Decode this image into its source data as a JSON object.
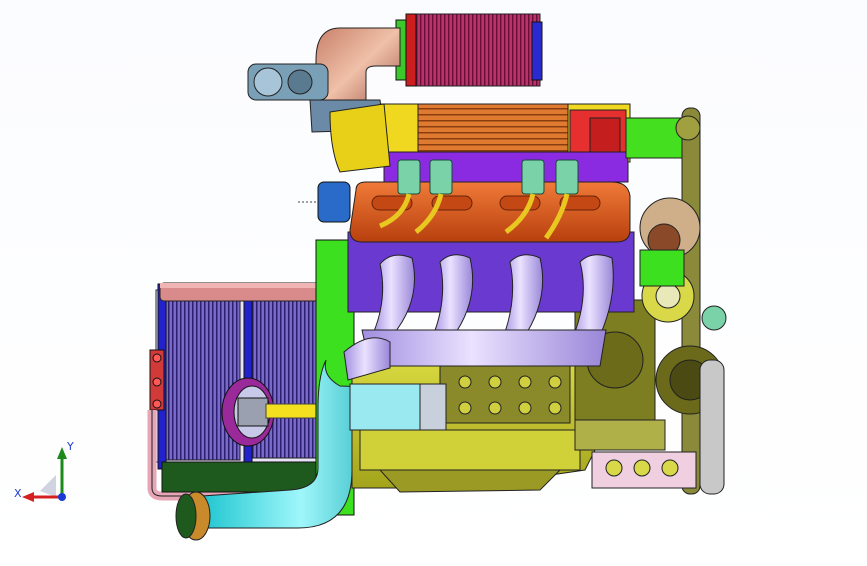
{
  "viewport": {
    "model": "supercharged-v8-engine-assembly",
    "colors": {
      "background": "#ffffff",
      "cylinder_head": "#d9531e",
      "intake_plenum": "#8a2be2",
      "block": "#c9c931",
      "headers": "#c8b8f0",
      "intercooler_pipe": "#36e0e8",
      "air_filter": "#b8326b",
      "bracket_green": "#3ce01e",
      "pulley_olive": "#7d7d22"
    }
  },
  "triad": {
    "y_label": "Y",
    "x_label": "X",
    "y_color": "#1a8a1a",
    "x_color": "#d42020",
    "z_color": "#1a3ad6"
  }
}
